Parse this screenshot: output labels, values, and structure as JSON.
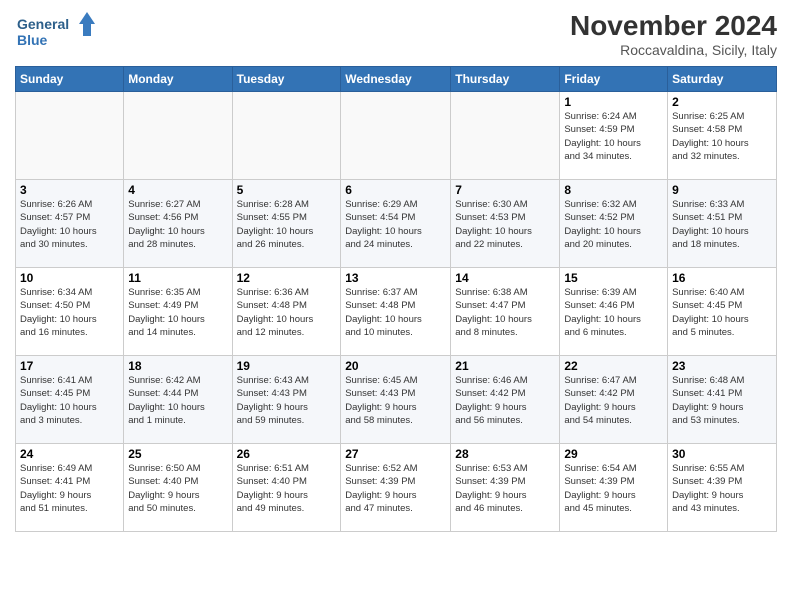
{
  "logo": {
    "line1": "General",
    "line2": "Blue"
  },
  "title": "November 2024",
  "location": "Roccavaldina, Sicily, Italy",
  "weekdays": [
    "Sunday",
    "Monday",
    "Tuesday",
    "Wednesday",
    "Thursday",
    "Friday",
    "Saturday"
  ],
  "weeks": [
    [
      {
        "day": "",
        "info": ""
      },
      {
        "day": "",
        "info": ""
      },
      {
        "day": "",
        "info": ""
      },
      {
        "day": "",
        "info": ""
      },
      {
        "day": "",
        "info": ""
      },
      {
        "day": "1",
        "info": "Sunrise: 6:24 AM\nSunset: 4:59 PM\nDaylight: 10 hours\nand 34 minutes."
      },
      {
        "day": "2",
        "info": "Sunrise: 6:25 AM\nSunset: 4:58 PM\nDaylight: 10 hours\nand 32 minutes."
      }
    ],
    [
      {
        "day": "3",
        "info": "Sunrise: 6:26 AM\nSunset: 4:57 PM\nDaylight: 10 hours\nand 30 minutes."
      },
      {
        "day": "4",
        "info": "Sunrise: 6:27 AM\nSunset: 4:56 PM\nDaylight: 10 hours\nand 28 minutes."
      },
      {
        "day": "5",
        "info": "Sunrise: 6:28 AM\nSunset: 4:55 PM\nDaylight: 10 hours\nand 26 minutes."
      },
      {
        "day": "6",
        "info": "Sunrise: 6:29 AM\nSunset: 4:54 PM\nDaylight: 10 hours\nand 24 minutes."
      },
      {
        "day": "7",
        "info": "Sunrise: 6:30 AM\nSunset: 4:53 PM\nDaylight: 10 hours\nand 22 minutes."
      },
      {
        "day": "8",
        "info": "Sunrise: 6:32 AM\nSunset: 4:52 PM\nDaylight: 10 hours\nand 20 minutes."
      },
      {
        "day": "9",
        "info": "Sunrise: 6:33 AM\nSunset: 4:51 PM\nDaylight: 10 hours\nand 18 minutes."
      }
    ],
    [
      {
        "day": "10",
        "info": "Sunrise: 6:34 AM\nSunset: 4:50 PM\nDaylight: 10 hours\nand 16 minutes."
      },
      {
        "day": "11",
        "info": "Sunrise: 6:35 AM\nSunset: 4:49 PM\nDaylight: 10 hours\nand 14 minutes."
      },
      {
        "day": "12",
        "info": "Sunrise: 6:36 AM\nSunset: 4:48 PM\nDaylight: 10 hours\nand 12 minutes."
      },
      {
        "day": "13",
        "info": "Sunrise: 6:37 AM\nSunset: 4:48 PM\nDaylight: 10 hours\nand 10 minutes."
      },
      {
        "day": "14",
        "info": "Sunrise: 6:38 AM\nSunset: 4:47 PM\nDaylight: 10 hours\nand 8 minutes."
      },
      {
        "day": "15",
        "info": "Sunrise: 6:39 AM\nSunset: 4:46 PM\nDaylight: 10 hours\nand 6 minutes."
      },
      {
        "day": "16",
        "info": "Sunrise: 6:40 AM\nSunset: 4:45 PM\nDaylight: 10 hours\nand 5 minutes."
      }
    ],
    [
      {
        "day": "17",
        "info": "Sunrise: 6:41 AM\nSunset: 4:45 PM\nDaylight: 10 hours\nand 3 minutes."
      },
      {
        "day": "18",
        "info": "Sunrise: 6:42 AM\nSunset: 4:44 PM\nDaylight: 10 hours\nand 1 minute."
      },
      {
        "day": "19",
        "info": "Sunrise: 6:43 AM\nSunset: 4:43 PM\nDaylight: 9 hours\nand 59 minutes."
      },
      {
        "day": "20",
        "info": "Sunrise: 6:45 AM\nSunset: 4:43 PM\nDaylight: 9 hours\nand 58 minutes."
      },
      {
        "day": "21",
        "info": "Sunrise: 6:46 AM\nSunset: 4:42 PM\nDaylight: 9 hours\nand 56 minutes."
      },
      {
        "day": "22",
        "info": "Sunrise: 6:47 AM\nSunset: 4:42 PM\nDaylight: 9 hours\nand 54 minutes."
      },
      {
        "day": "23",
        "info": "Sunrise: 6:48 AM\nSunset: 4:41 PM\nDaylight: 9 hours\nand 53 minutes."
      }
    ],
    [
      {
        "day": "24",
        "info": "Sunrise: 6:49 AM\nSunset: 4:41 PM\nDaylight: 9 hours\nand 51 minutes."
      },
      {
        "day": "25",
        "info": "Sunrise: 6:50 AM\nSunset: 4:40 PM\nDaylight: 9 hours\nand 50 minutes."
      },
      {
        "day": "26",
        "info": "Sunrise: 6:51 AM\nSunset: 4:40 PM\nDaylight: 9 hours\nand 49 minutes."
      },
      {
        "day": "27",
        "info": "Sunrise: 6:52 AM\nSunset: 4:39 PM\nDaylight: 9 hours\nand 47 minutes."
      },
      {
        "day": "28",
        "info": "Sunrise: 6:53 AM\nSunset: 4:39 PM\nDaylight: 9 hours\nand 46 minutes."
      },
      {
        "day": "29",
        "info": "Sunrise: 6:54 AM\nSunset: 4:39 PM\nDaylight: 9 hours\nand 45 minutes."
      },
      {
        "day": "30",
        "info": "Sunrise: 6:55 AM\nSunset: 4:39 PM\nDaylight: 9 hours\nand 43 minutes."
      }
    ]
  ]
}
